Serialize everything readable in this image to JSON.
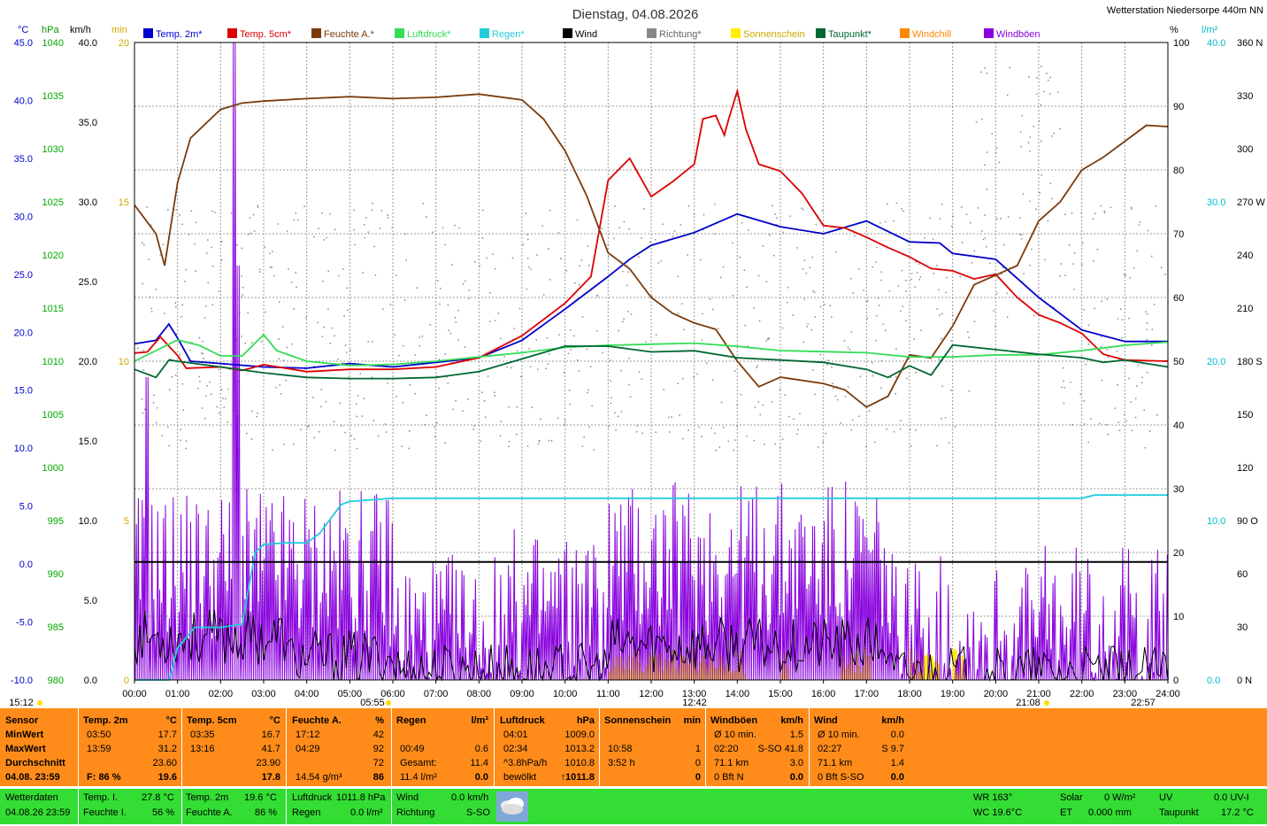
{
  "header": {
    "title": "Dienstag, 04.08.2026",
    "station": "Wetterstation Niedersorpe 440m NN"
  },
  "colors": {
    "temp2m": "#0000cc",
    "temp5cm": "#dd0000",
    "feuchte": "#7a3b0c",
    "luftdruck": "#33dd55",
    "regen": "#22ccdd",
    "wind": "#000000",
    "richtung": "#888888",
    "sonne": "#ffee00",
    "taupunkt": "#006633",
    "windchill": "#ff8800",
    "windboeen": "#8800dd"
  },
  "legend": [
    {
      "label": "Temp. 2m*",
      "color": "#0000cc"
    },
    {
      "label": "Temp. 5cm*",
      "color": "#dd0000"
    },
    {
      "label": "Feuchte A.*",
      "color": "#7a3b0c"
    },
    {
      "label": "Luftdruck*",
      "color": "#33dd55"
    },
    {
      "label": "Regen*",
      "color": "#22ccdd"
    },
    {
      "label": "Wind",
      "color": "#000000"
    },
    {
      "label": "Richtung*",
      "color": "#888888"
    },
    {
      "label": "Sonnenschein",
      "color": "#ffee00"
    },
    {
      "label": "Taupunkt*",
      "color": "#006633"
    },
    {
      "label": "Windchill",
      "color": "#ff8800"
    },
    {
      "label": "Windböen",
      "color": "#8800dd"
    }
  ],
  "axis_units": {
    "temp": "°C",
    "hpa": "hPa",
    "kmh": "km/h",
    "min": "min",
    "pct": "%",
    "rain": "l/m²"
  },
  "chart_data": {
    "type": "line",
    "x_ticks": [
      "00:00",
      "01:00",
      "02:00",
      "03:00",
      "04:00",
      "05:00",
      "06:00",
      "07:00",
      "08:00",
      "09:00",
      "10:00",
      "11:00",
      "12:00",
      "13:00",
      "14:00",
      "15:00",
      "16:00",
      "17:00",
      "18:00",
      "19:00",
      "20:00",
      "21:00",
      "22:00",
      "23:00",
      "24:00"
    ],
    "axes": {
      "temp": {
        "range": [
          -10,
          45
        ],
        "ticks": [
          "45.0",
          "40.0",
          "35.0",
          "30.0",
          "25.0",
          "20.0",
          "15.0",
          "10.0",
          "5.0",
          "0.0",
          "-5.0",
          "-10.0"
        ]
      },
      "hpa": {
        "range": [
          980,
          1040
        ],
        "ticks": [
          "1040",
          "1035",
          "1030",
          "1025",
          "1020",
          "1015",
          "1010",
          "1005",
          "1000",
          "995",
          "990",
          "985",
          "980"
        ]
      },
      "kmh": {
        "range": [
          0,
          40
        ],
        "ticks": [
          "40.0",
          "35.0",
          "30.0",
          "25.0",
          "20.0",
          "15.0",
          "10.0",
          "5.0",
          "0.0"
        ]
      },
      "min": {
        "range": [
          0,
          20
        ],
        "ticks": [
          "20",
          "15",
          "10",
          "5",
          "0"
        ]
      },
      "pct": {
        "range": [
          0,
          100
        ],
        "ticks": [
          "100",
          "90",
          "80",
          "70",
          "60",
          "50",
          "40",
          "30",
          "20",
          "10",
          "0"
        ]
      },
      "rain": {
        "range": [
          0,
          40
        ],
        "ticks": [
          "40.0",
          "30.0",
          "20.0",
          "10.0",
          "0.0"
        ]
      },
      "dir": {
        "ticks": [
          "360 N",
          "330",
          "300",
          "270 W",
          "240",
          "210",
          "180 S",
          "150",
          "120",
          "90 O",
          "60",
          "30",
          "0 N"
        ]
      }
    },
    "series": [
      {
        "name": "Temp. 2m*",
        "axis": "temp",
        "color": "#0000cc",
        "points": [
          [
            0,
            19
          ],
          [
            0.5,
            19.3
          ],
          [
            0.8,
            20.7
          ],
          [
            1,
            19.5
          ],
          [
            1.3,
            17.5
          ],
          [
            2,
            17.3
          ],
          [
            3,
            17
          ],
          [
            4,
            16.9
          ],
          [
            5,
            17.3
          ],
          [
            6,
            17
          ],
          [
            7,
            17.4
          ],
          [
            8,
            17.8
          ],
          [
            9,
            19.3
          ],
          [
            10,
            22
          ],
          [
            11,
            24.8
          ],
          [
            11.5,
            26.3
          ],
          [
            12,
            27.5
          ],
          [
            13,
            28.6
          ],
          [
            14,
            30.2
          ],
          [
            15,
            29.1
          ],
          [
            16,
            28.5
          ],
          [
            17,
            29.6
          ],
          [
            18,
            27.8
          ],
          [
            18.7,
            27.7
          ],
          [
            19,
            26.8
          ],
          [
            20,
            26.3
          ],
          [
            21,
            23
          ],
          [
            22,
            20.2
          ],
          [
            23,
            19.2
          ],
          [
            24,
            19.2
          ]
        ]
      },
      {
        "name": "Temp. 5cm*",
        "axis": "temp",
        "color": "#dd0000",
        "points": [
          [
            0,
            18.2
          ],
          [
            0.3,
            18.3
          ],
          [
            0.6,
            19.6
          ],
          [
            1,
            18
          ],
          [
            1.2,
            16.9
          ],
          [
            2,
            17
          ],
          [
            2.5,
            16.7
          ],
          [
            3,
            17.2
          ],
          [
            4,
            16.6
          ],
          [
            5,
            16.8
          ],
          [
            6,
            16.8
          ],
          [
            7,
            17
          ],
          [
            8,
            17.8
          ],
          [
            9,
            19.7
          ],
          [
            10,
            22.5
          ],
          [
            10.6,
            24.8
          ],
          [
            11,
            33.1
          ],
          [
            11.5,
            35
          ],
          [
            12,
            31.7
          ],
          [
            12.5,
            33
          ],
          [
            13,
            34.5
          ],
          [
            13.2,
            38.4
          ],
          [
            13.5,
            38.7
          ],
          [
            13.7,
            37
          ],
          [
            13.8,
            38.4
          ],
          [
            14,
            40.8
          ],
          [
            14.2,
            37.5
          ],
          [
            14.5,
            34.5
          ],
          [
            15,
            33.9
          ],
          [
            15.5,
            32
          ],
          [
            16,
            29.2
          ],
          [
            16.5,
            29
          ],
          [
            17,
            28.2
          ],
          [
            17.5,
            27.3
          ],
          [
            18,
            26.5
          ],
          [
            18.5,
            25.5
          ],
          [
            19,
            25.3
          ],
          [
            19.5,
            24.6
          ],
          [
            20,
            25
          ],
          [
            20.5,
            23
          ],
          [
            21,
            21.5
          ],
          [
            21.5,
            20.8
          ],
          [
            22,
            19.9
          ],
          [
            22.5,
            18.1
          ],
          [
            23,
            17.6
          ],
          [
            24,
            17.5
          ]
        ]
      },
      {
        "name": "Feuchte A.*",
        "axis": "pct",
        "color": "#7a3b0c",
        "points": [
          [
            0,
            74.5
          ],
          [
            0.5,
            70
          ],
          [
            0.7,
            65
          ],
          [
            1,
            78
          ],
          [
            1.3,
            85
          ],
          [
            2,
            89.5
          ],
          [
            2.5,
            90.5
          ],
          [
            3,
            90.8
          ],
          [
            4,
            91.2
          ],
          [
            5,
            91.5
          ],
          [
            6,
            91.2
          ],
          [
            7,
            91.4
          ],
          [
            8,
            91.9
          ],
          [
            9,
            91
          ],
          [
            9.5,
            88
          ],
          [
            10,
            83
          ],
          [
            10.5,
            76
          ],
          [
            11,
            67
          ],
          [
            11.5,
            64.5
          ],
          [
            12,
            60
          ],
          [
            12.5,
            57.5
          ],
          [
            13,
            56
          ],
          [
            13.5,
            55
          ],
          [
            14,
            50
          ],
          [
            14.5,
            46
          ],
          [
            15,
            47.5
          ],
          [
            16,
            46.5
          ],
          [
            16.5,
            45.5
          ],
          [
            17,
            42.8
          ],
          [
            17.5,
            44.5
          ],
          [
            18,
            51
          ],
          [
            18.5,
            50.5
          ],
          [
            19,
            55.5
          ],
          [
            19.5,
            62
          ],
          [
            20,
            63.5
          ],
          [
            20.5,
            65
          ],
          [
            21,
            72
          ],
          [
            21.5,
            75
          ],
          [
            22,
            80
          ],
          [
            22.5,
            82
          ],
          [
            23,
            84.5
          ],
          [
            23.5,
            87
          ],
          [
            24,
            86.8
          ]
        ]
      },
      {
        "name": "Luftdruck*",
        "axis": "hpa",
        "color": "#33dd55",
        "points": [
          [
            0,
            1010
          ],
          [
            0.5,
            1011
          ],
          [
            1,
            1012
          ],
          [
            1.5,
            1011.5
          ],
          [
            2,
            1010.5
          ],
          [
            2.5,
            1010.5
          ],
          [
            3,
            1012.5
          ],
          [
            3.3,
            1011
          ],
          [
            4,
            1010
          ],
          [
            5,
            1009.6
          ],
          [
            6,
            1009.7
          ],
          [
            7,
            1010
          ],
          [
            8,
            1010.4
          ],
          [
            9,
            1010.8
          ],
          [
            10,
            1011.3
          ],
          [
            11,
            1011.5
          ],
          [
            12,
            1011.6
          ],
          [
            13,
            1011.7
          ],
          [
            14,
            1011.4
          ],
          [
            15,
            1011
          ],
          [
            16,
            1010.9
          ],
          [
            17,
            1010.8
          ],
          [
            18,
            1010.4
          ],
          [
            19,
            1010.4
          ],
          [
            20,
            1010.6
          ],
          [
            21,
            1010.6
          ],
          [
            22,
            1011
          ],
          [
            23,
            1011.5
          ],
          [
            24,
            1011.8
          ]
        ]
      },
      {
        "name": "Taupunkt*",
        "axis": "temp",
        "color": "#006633",
        "points": [
          [
            0,
            16.8
          ],
          [
            0.5,
            16.1
          ],
          [
            0.8,
            17.6
          ],
          [
            1,
            17.5
          ],
          [
            2,
            17
          ],
          [
            3,
            16.5
          ],
          [
            4,
            16.1
          ],
          [
            5,
            16
          ],
          [
            6,
            16
          ],
          [
            7,
            16.1
          ],
          [
            8,
            16.6
          ],
          [
            9,
            17.7
          ],
          [
            10,
            18.8
          ],
          [
            11,
            18.8
          ],
          [
            12,
            18.3
          ],
          [
            13,
            18.4
          ],
          [
            14,
            17.8
          ],
          [
            15,
            17.6
          ],
          [
            16,
            17.4
          ],
          [
            17,
            16.8
          ],
          [
            17.5,
            16.1
          ],
          [
            18,
            17.1
          ],
          [
            18.5,
            16.3
          ],
          [
            19,
            18.9
          ],
          [
            20,
            18.5
          ],
          [
            21,
            18.1
          ],
          [
            22,
            17.8
          ],
          [
            22.5,
            17.4
          ],
          [
            23,
            17.6
          ],
          [
            24,
            17
          ]
        ]
      },
      {
        "name": "Regen*",
        "axis": "rain",
        "color": "#22ccdd",
        "points": [
          [
            0,
            0
          ],
          [
            0.8,
            0
          ],
          [
            1,
            2
          ],
          [
            1.4,
            3.3
          ],
          [
            2,
            3.3
          ],
          [
            2.5,
            3.5
          ],
          [
            2.8,
            8
          ],
          [
            3,
            8.5
          ],
          [
            3.5,
            8.6
          ],
          [
            4,
            8.6
          ],
          [
            4.3,
            9.2
          ],
          [
            4.8,
            11
          ],
          [
            5,
            11.2
          ],
          [
            6,
            11.4
          ],
          [
            10,
            11.4
          ],
          [
            20,
            11.4
          ],
          [
            22,
            11.4
          ],
          [
            22.3,
            11.6
          ],
          [
            24,
            11.6
          ]
        ]
      },
      {
        "name": "Wind",
        "axis": "kmh",
        "color": "#000000",
        "points": [
          [
            0,
            7.4
          ],
          [
            24,
            7.4
          ]
        ]
      }
    ],
    "sunrise": "05:55",
    "sunset": "21:08",
    "moonrise": "22:57",
    "moonset": "15:12",
    "solar_noon": "12:42"
  },
  "table": {
    "headers": [
      {
        "label": "Sensor",
        "unit": ""
      },
      {
        "label": "Temp. 2m",
        "unit": "°C"
      },
      {
        "label": "Temp. 5cm",
        "unit": "°C"
      },
      {
        "label": "Feuchte A.",
        "unit": "%"
      },
      {
        "label": "Regen",
        "unit": "l/m²"
      },
      {
        "label": "Luftdruck",
        "unit": "hPa"
      },
      {
        "label": "Sonnenschein",
        "unit": "min"
      },
      {
        "label": "Windböen",
        "unit": "km/h"
      },
      {
        "label": "Wind",
        "unit": "km/h"
      }
    ],
    "rows": [
      [
        "MinWert",
        "03:50",
        "17.7",
        "03:35",
        "16.7",
        "17:12",
        "42",
        "",
        "",
        "04:01",
        "1009.0",
        "",
        "",
        "Ø 10 min.",
        "1.5",
        "Ø 10 min.",
        "0.0"
      ],
      [
        "MaxWert",
        "13:59",
        "31.2",
        "13:16",
        "41.7",
        "04:29",
        "92",
        "00:49",
        "0.6",
        "02:34",
        "1013.2",
        "10:58",
        "1",
        "02:20",
        "S-SO 41.8",
        "02:27",
        "S 9.7"
      ],
      [
        "Durchschnitt",
        "",
        "23.60",
        "",
        "23.90",
        "",
        "72",
        "Gesamt:",
        "11.4",
        "^3.8hPa/h",
        "1010.8",
        "3:52 h",
        "0",
        "71.1 km",
        "3.0",
        "71.1 km",
        "1.4"
      ],
      [
        "04.08. 23:59",
        "F: 86 %",
        "19.6",
        "",
        "17.8",
        "14.54 g/m³",
        "86",
        "11.4 l/m²",
        "0.0",
        "bewölkt",
        "↑1011.8",
        "",
        "0",
        "0 Bft N",
        "0.0",
        "0 Bft S-SO",
        "0.0"
      ]
    ]
  },
  "status": {
    "wetterdaten_label": "Wetterdaten",
    "wetterdaten_time": "04.08.26 23:59",
    "temp_i_label": "Temp. I.",
    "temp_i": "27.8 °C",
    "feuchte_i_label": "Feuchte I.",
    "feuchte_i": "56 %",
    "temp2m_label": "Temp. 2m",
    "temp2m": "19.6 °C",
    "feuchte_a_label": "Feuchte A.",
    "feuchte_a": "86 %",
    "luftdruck_label": "Luftdruck",
    "luftdruck": "1011.8 hPa",
    "regen_label": "Regen",
    "regen": "0.0 l/m²",
    "wind_label": "Wind",
    "wind": "0.0 km/h",
    "richtung_label": "Richtung",
    "richtung": "S-SO",
    "wr": "WR 163°",
    "wc": "WC 19.6°C",
    "solar_label": "Solar",
    "solar": "0 W/m²",
    "et_label": "ET",
    "et": "0.000 mm",
    "uv_label": "UV",
    "uv": "0.0 UV-I",
    "taupunkt_label": "Taupunkt",
    "taupunkt": "17.2 °C"
  }
}
